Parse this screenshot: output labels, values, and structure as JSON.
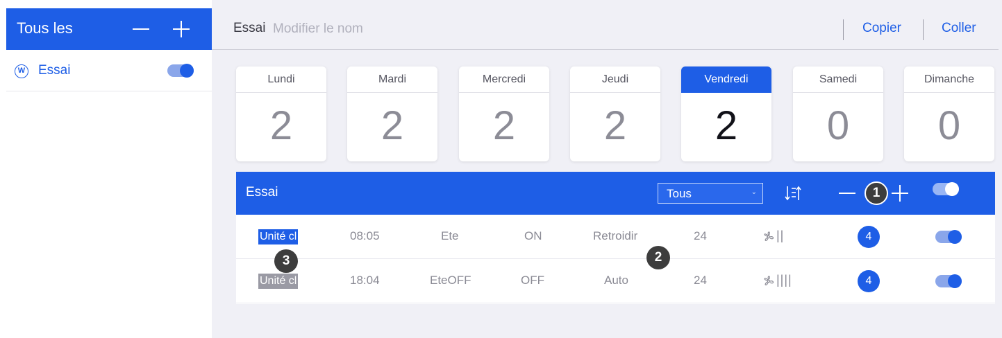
{
  "sidebar": {
    "title": "Tous les",
    "items": [
      {
        "icon": "w-icon",
        "glyph": "W",
        "label": "Essai",
        "enabled": true
      }
    ]
  },
  "topbar": {
    "program_name": "Essai",
    "rename_placeholder": "Modifier le nom",
    "copy_label": "Copier",
    "paste_label": "Coller"
  },
  "days": [
    {
      "name": "Lundi",
      "count": "2"
    },
    {
      "name": "Mardi",
      "count": "2"
    },
    {
      "name": "Mercredi",
      "count": "2"
    },
    {
      "name": "Jeudi",
      "count": "2"
    },
    {
      "name": "Vendredi",
      "count": "2",
      "active": true
    },
    {
      "name": "Samedi",
      "count": "0"
    },
    {
      "name": "Dimanche",
      "count": "0"
    }
  ],
  "schedule": {
    "title": "Essai",
    "filter": {
      "selected": "Tous"
    },
    "rows": [
      {
        "unit": "Unité cl",
        "time": "08:05",
        "season": "Ete",
        "power": "ON",
        "mode": "Retroidir",
        "temp": "24",
        "fan_speed_bars": "||",
        "devices": "4",
        "enabled": true
      },
      {
        "unit": "Unité cl",
        "time": "18:04",
        "season": "EteOFF",
        "power": "OFF",
        "mode": "Auto",
        "temp": "24",
        "fan_speed_bars": "||||",
        "devices": "4",
        "enabled": true
      }
    ]
  },
  "callouts": [
    "1",
    "2",
    "3"
  ],
  "colors": {
    "accent": "#1e5ee6",
    "background": "#f0f0f6",
    "muted_text": "#8a8a94",
    "callout": "#3d3d3d"
  }
}
